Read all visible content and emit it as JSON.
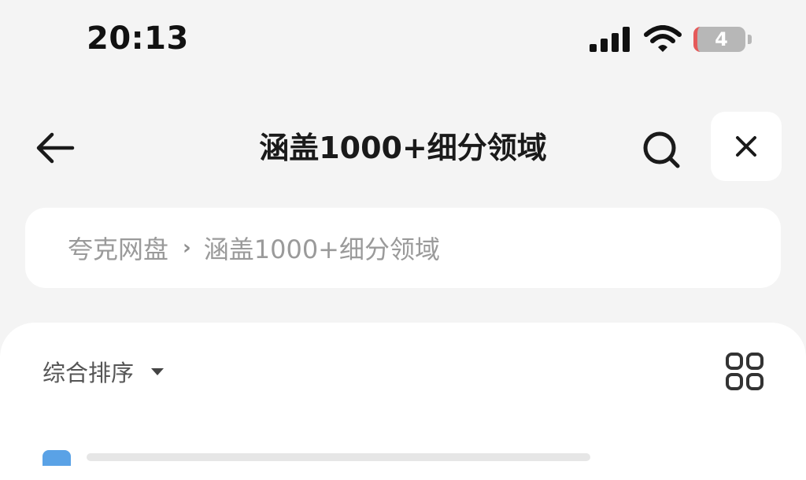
{
  "status_bar": {
    "time": "20:13",
    "battery_level": "4",
    "icons": [
      "signal-icon",
      "wifi-icon",
      "battery-icon"
    ],
    "battery_color": "#e55a5a"
  },
  "nav": {
    "title": "涵盖1000+细分领域",
    "icons": [
      "back-arrow-icon",
      "search-icon",
      "close-icon"
    ]
  },
  "breadcrumb": {
    "items": [
      "夸克网盘",
      "涵盖1000+细分领域"
    ],
    "separator": "›"
  },
  "toolbar": {
    "sort_label": "综合排序",
    "icons": [
      "caret-down-icon",
      "grid-view-icon"
    ]
  },
  "colors": {
    "background": "#f4f4f4",
    "card": "#ffffff",
    "text_primary": "#1a1a1a",
    "text_muted": "#9a9a9a"
  }
}
